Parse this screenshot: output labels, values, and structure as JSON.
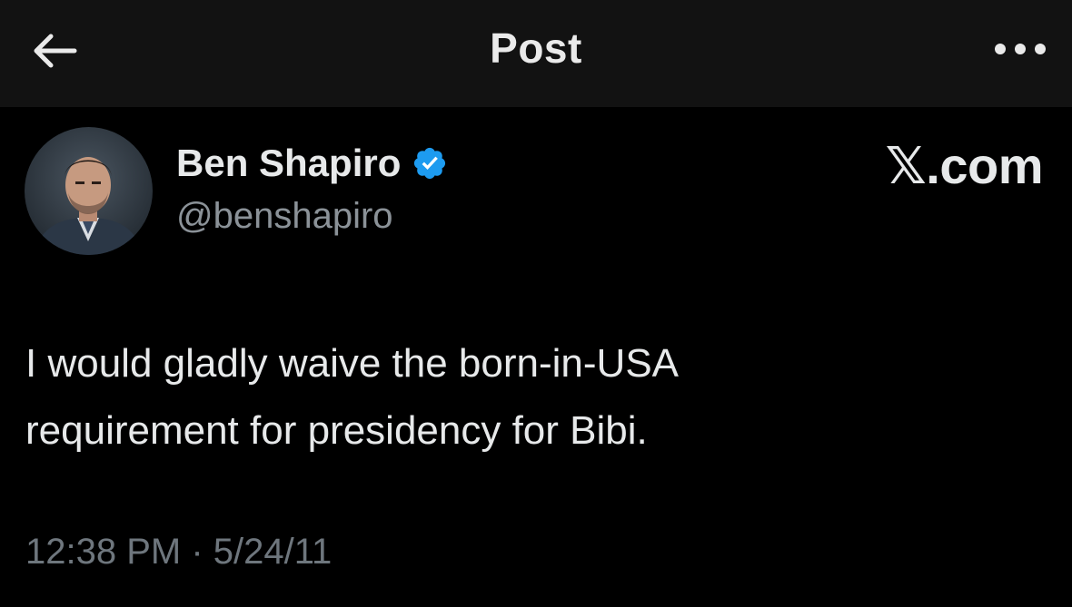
{
  "header": {
    "title": "Post",
    "back_icon": "arrow-left-icon",
    "more_icon": "more-horizontal-icon"
  },
  "author": {
    "display_name": "Ben Shapiro",
    "handle": "@benshapiro",
    "verified_icon": "verified-badge-icon",
    "verified_color": "#1d9bf0"
  },
  "brand": {
    "x": "𝕏",
    "suffix": ".com"
  },
  "tweet": {
    "lines": [
      "I would gladly waive the born-in-USA",
      "requirement for presidency for Bibi."
    ]
  },
  "meta": {
    "timestamp": "12:38 PM · 5/24/11"
  },
  "colors": {
    "background": "#000000",
    "header_bg": "#121212",
    "text": "#e7e9ea",
    "secondary_text": "#8b9298",
    "timestamp_text": "#6e767d"
  }
}
